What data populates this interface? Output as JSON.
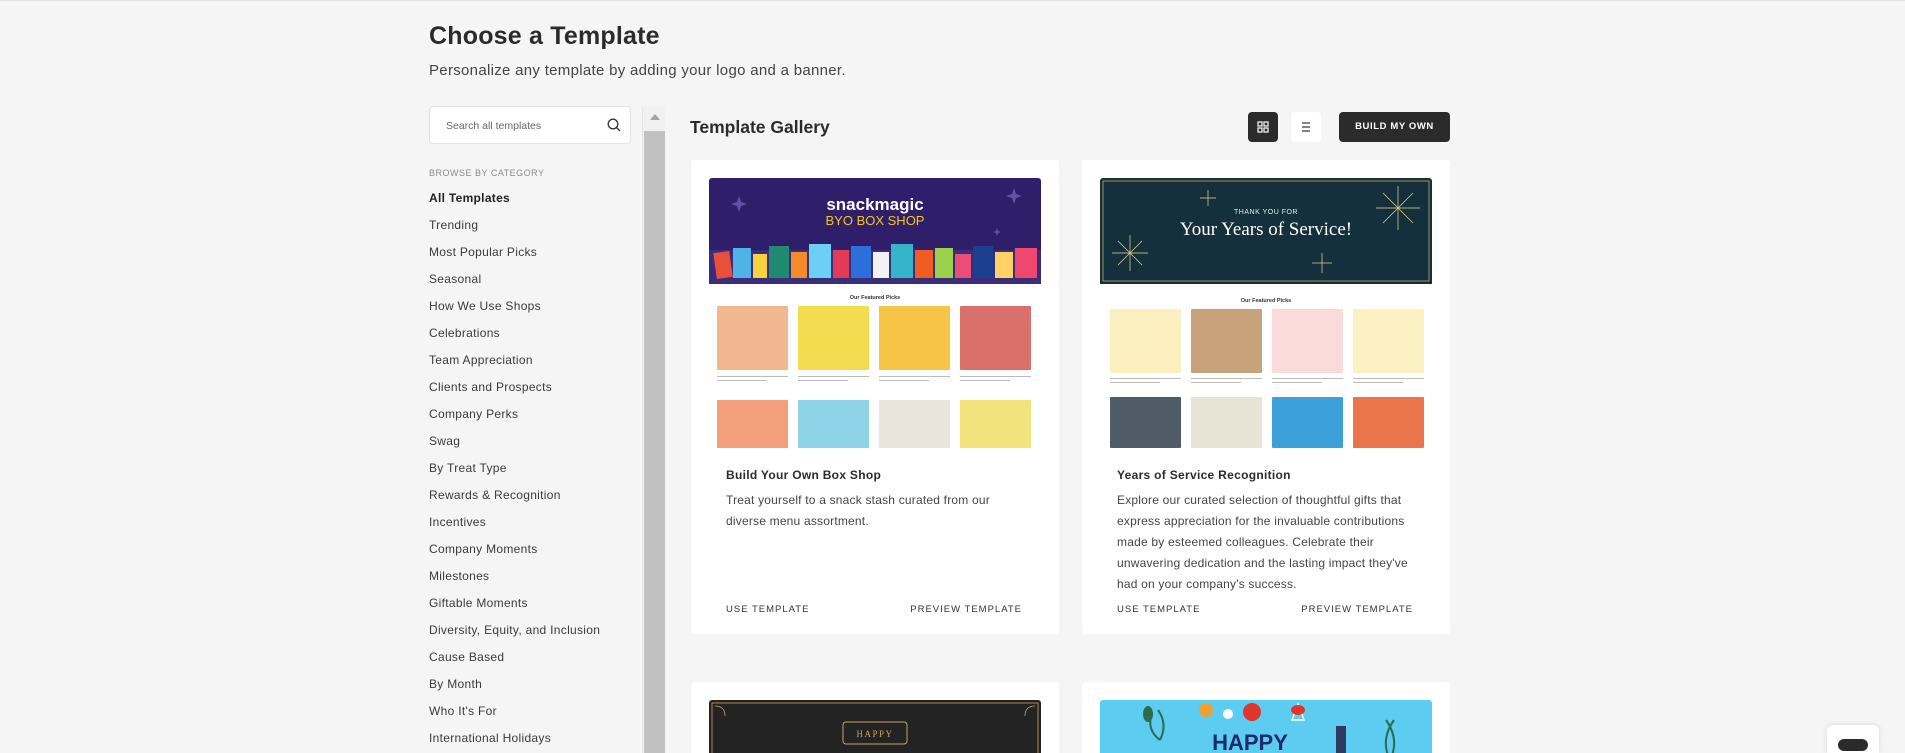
{
  "header": {
    "title": "Choose a Template",
    "subtitle": "Personalize any template by adding your logo and a banner."
  },
  "sidebar": {
    "search_placeholder": "Search all templates",
    "browse_label": "BROWSE BY CATEGORY",
    "categories": [
      "All Templates",
      "Trending",
      "Most Popular Picks",
      "Seasonal",
      "How We Use Shops",
      "Celebrations",
      "Team Appreciation",
      "Clients and Prospects",
      "Company Perks",
      "Swag",
      "By Treat Type",
      "Rewards & Recognition",
      "Incentives",
      "Company Moments",
      "Milestones",
      "Giftable Moments",
      "Diversity, Equity, and Inclusion",
      "Cause Based",
      "By Month",
      "Who It's For",
      "International Holidays"
    ]
  },
  "gallery": {
    "title": "Template Gallery",
    "build_label": "BUILD MY OWN",
    "cards": [
      {
        "name": "Build Your Own Box Shop",
        "description": "Treat yourself to a snack stash curated from our diverse menu assortment.",
        "use_label": "USE TEMPLATE",
        "preview_label": "PREVIEW TEMPLATE",
        "banner_brand": "snackmagic",
        "banner_line": "BYO BOX SHOP",
        "featured_label": "Our Featured Picks",
        "banner_color": "#2f1f6b"
      },
      {
        "name": "Years of Service Recognition",
        "description": "Explore our curated selection of thoughtful gifts that express appreciation for the invaluable contributions made by esteemed colleagues. Celebrate their unwavering dedication and the lasting impact they've had on your company's success.",
        "use_label": "USE TEMPLATE",
        "preview_label": "PREVIEW TEMPLATE",
        "banner_kicker": "THANK YOU FOR",
        "banner_line": "Your Years of Service!",
        "featured_label": "Our Featured Picks",
        "banner_color": "#15303d"
      },
      {
        "banner_line": "HAPPY",
        "banner_color": "#232323"
      },
      {
        "banner_line": "HAPPY",
        "banner_color": "#5ccdf0"
      }
    ]
  },
  "colors": {
    "background": "#f5f5f5",
    "dark_button": "#2b2b2b",
    "card": "#ffffff"
  }
}
